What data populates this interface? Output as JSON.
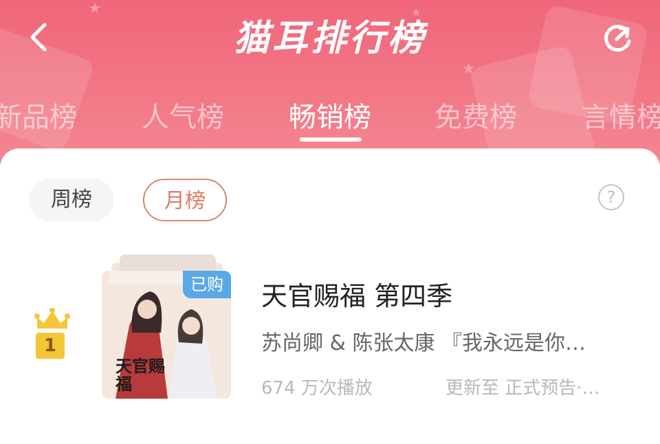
{
  "header": {
    "title": "猫耳排行榜",
    "back_icon": "chevron-left-icon",
    "refresh_icon": "refresh-icon"
  },
  "tabs": [
    {
      "label": "新品榜",
      "active": false
    },
    {
      "label": "人气榜",
      "active": false
    },
    {
      "label": "畅销榜",
      "active": true
    },
    {
      "label": "免费榜",
      "active": false
    },
    {
      "label": "言情榜",
      "active": false
    }
  ],
  "period_filters": {
    "week_label": "周榜",
    "month_label": "月榜",
    "selected": "月榜",
    "help_icon": "question-circle-icon",
    "help_glyph": "?"
  },
  "ranking": [
    {
      "rank": "1",
      "badge_icon": "crown-icon",
      "title": "天官赐福 第四季",
      "cast": "苏尚卿 & 陈张太康 『我永远是你…",
      "plays": "674 万次播放",
      "update": "更新至 正式预告·…",
      "purchased_label": "已购",
      "cover_text": "天官赐福"
    }
  ],
  "colors": {
    "header": "#f0667a",
    "active_pill_border": "#e0826a",
    "purchased_badge": "#5aa8e6",
    "crown": "#f5c53a"
  }
}
